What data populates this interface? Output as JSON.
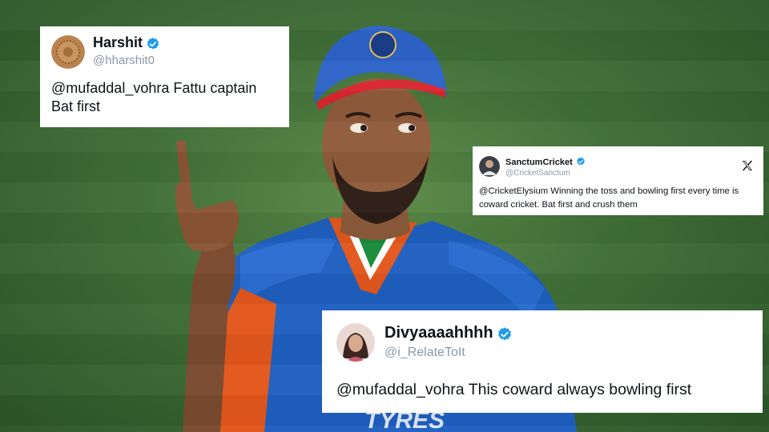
{
  "colors": {
    "field_green": "#3f6e36",
    "jersey_blue": "#1f5fc0",
    "jersey_orange": "#e2571c",
    "verified_blue": "#1d9bf0",
    "card_bg": "#ffffff"
  },
  "tweets": [
    {
      "name": "Harshit",
      "handle": "@hharshit0",
      "verified": true,
      "avatar_icon": "coin-avatar-icon",
      "text": "@mufaddal_vohra Fattu captain\nBat first"
    },
    {
      "name": "SanctumCricket",
      "handle": "@CricketSanctum",
      "verified": true,
      "avatar_icon": "player-avatar-icon",
      "platform_icon": "x-logo-icon",
      "text": "@CricketElysium Winning the toss and bowling first every time is coward cricket. Bat first and crush them"
    },
    {
      "name": "Divyaaaahhhh",
      "handle": "@i_RelateToIt",
      "verified": true,
      "avatar_icon": "selfie-avatar-icon",
      "text": "@mufaddal_vohra This coward always bowling first"
    }
  ]
}
